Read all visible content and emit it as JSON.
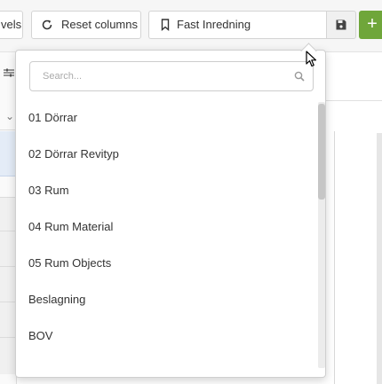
{
  "toolbar": {
    "levels_label": "vels",
    "reset_columns_label": "Reset columns",
    "view_selector_label": "Fast Inredning",
    "save_icon": "save-icon",
    "add_label": "+",
    "colors": {
      "add_bg": "#6fa63a"
    }
  },
  "dropdown": {
    "search_placeholder": "Search...",
    "search_value": "",
    "items": [
      {
        "label": "01 Dörrar"
      },
      {
        "label": "02 Dörrar Revityp"
      },
      {
        "label": "03 Rum"
      },
      {
        "label": "04 Rum Material"
      },
      {
        "label": "05 Rum Objects"
      },
      {
        "label": "Beslagning"
      },
      {
        "label": "BOV"
      }
    ]
  }
}
